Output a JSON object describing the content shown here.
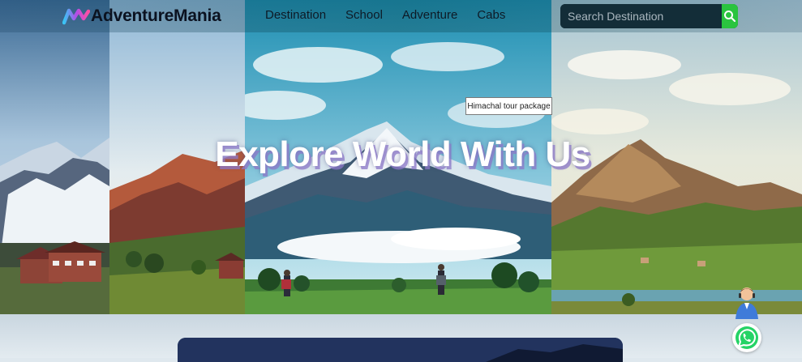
{
  "brand": {
    "name": "AdventureMania"
  },
  "nav": {
    "items": [
      "Destination",
      "School",
      "Adventure",
      "Cabs"
    ]
  },
  "search": {
    "placeholder": "Search Destination",
    "value": ""
  },
  "hero": {
    "title": "Explore World With Us",
    "tooltip": "Himachal tour package"
  },
  "icons": {
    "search": "search-icon",
    "whatsapp": "whatsapp-icon",
    "support": "support-agent-icon"
  },
  "colors": {
    "accent_green": "#2ac43f",
    "whatsapp_green": "#25d366",
    "logo_gradient": [
      "#39c6f5",
      "#b14de8",
      "#ff4fa3"
    ]
  }
}
